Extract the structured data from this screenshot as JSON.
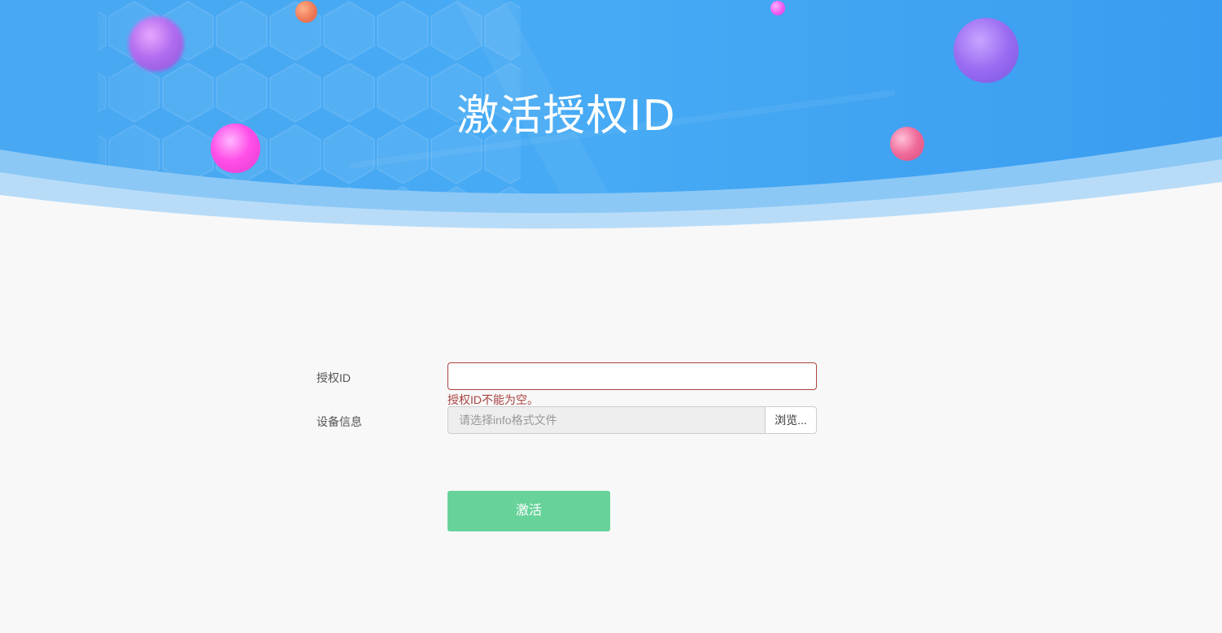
{
  "header": {
    "title": "激活授权ID"
  },
  "form": {
    "auth_id": {
      "label": "授权ID",
      "value": "",
      "error": "授权ID不能为空。"
    },
    "device_info": {
      "label": "设备信息",
      "placeholder": "请选择info格式文件",
      "browse_label": "浏览..."
    },
    "submit_label": "激活"
  },
  "colors": {
    "banner_blue": "#3aa0f0",
    "error": "#a94442",
    "submit_green": "#67d39a",
    "background": "#f8f8f8"
  }
}
